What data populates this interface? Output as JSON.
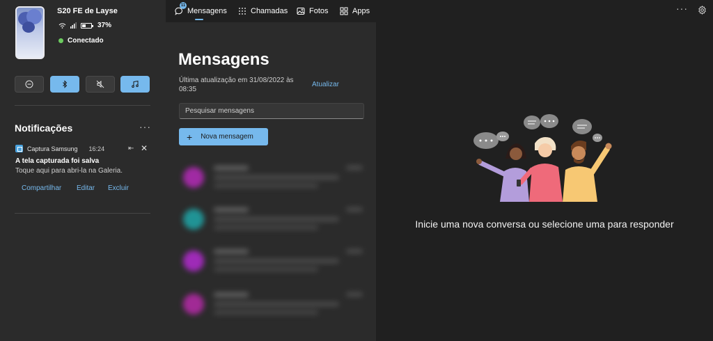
{
  "device": {
    "name": "S20 FE de Layse",
    "battery": "37%",
    "status": "Conectado"
  },
  "quick_actions": [
    {
      "name": "do-not-disturb",
      "active": false
    },
    {
      "name": "bluetooth",
      "active": true
    },
    {
      "name": "mute",
      "active": false
    },
    {
      "name": "media",
      "active": true
    }
  ],
  "notifications": {
    "title": "Notificações",
    "more": "···",
    "items": [
      {
        "app": "Captura Samsung",
        "time": "16:24",
        "title": "A tela capturada foi salva",
        "body": "Toque aqui para abri-la na Galeria.",
        "actions": [
          "Compartilhar",
          "Editar",
          "Excluir"
        ]
      }
    ]
  },
  "nav": {
    "badge": "11",
    "tabs": [
      {
        "label": "Mensagens",
        "icon": "chat-icon",
        "active": true
      },
      {
        "label": "Chamadas",
        "icon": "dialpad-icon",
        "active": false
      },
      {
        "label": "Fotos",
        "icon": "photos-icon",
        "active": false
      },
      {
        "label": "Apps",
        "icon": "apps-icon",
        "active": false
      }
    ],
    "more": "···"
  },
  "messages": {
    "title": "Mensagens",
    "last_update": "Última atualização em 31/08/2022 às 08:35",
    "refresh": "Atualizar",
    "search_placeholder": "Pesquisar mensagens",
    "new_message": "Nova mensagem",
    "plus": "+"
  },
  "empty_state": {
    "text": "Inicie uma nova conversa ou selecione uma para responder"
  },
  "colors": {
    "accent": "#76b9ed",
    "connected": "#6ccb5f",
    "panel": "#2b2b2b",
    "background": "#202020"
  }
}
